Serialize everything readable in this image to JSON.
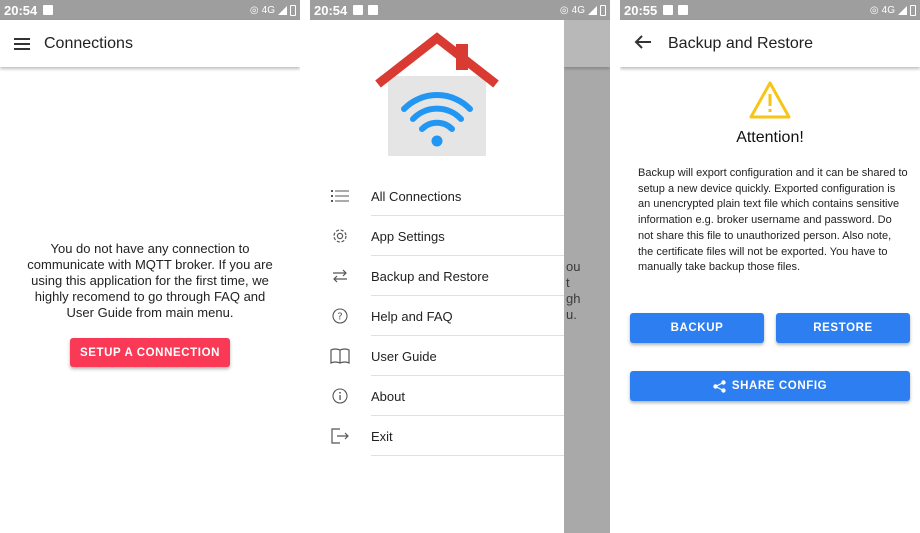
{
  "screen1": {
    "status_time": "20:54",
    "status_network": "4G",
    "title": "Connections",
    "empty_message": "You do not have any connection to communicate with MQTT broker. If you are using this application for the first time, we highly recomend to go through FAQ and User Guide from main menu.",
    "setup_button": "SETUP A CONNECTION"
  },
  "screen2": {
    "status_time": "20:54",
    "status_network": "4G",
    "background_text": [
      "ou",
      "t",
      "gh",
      "u."
    ],
    "drawer_items": [
      {
        "label": "All Connections",
        "icon": "list-icon"
      },
      {
        "label": "App Settings",
        "icon": "gear-icon"
      },
      {
        "label": "Backup and Restore",
        "icon": "swap-icon"
      },
      {
        "label": "Help and FAQ",
        "icon": "help-icon"
      },
      {
        "label": "User Guide",
        "icon": "book-icon"
      },
      {
        "label": "About",
        "icon": "info-icon"
      },
      {
        "label": "Exit",
        "icon": "exit-icon"
      }
    ]
  },
  "screen3": {
    "status_time": "20:55",
    "status_network": "4G",
    "title": "Backup and Restore",
    "attention": "Attention!",
    "paragraph": "Backup will export configuration and it can be shared to setup a new device quickly. Exported configuration is an unencrypted plain text file which contains sensitive information e.g. broker username and password. Do not share this file to unauthorized person. Also note, the certificate files will not be exported. You have to manually take backup those files.",
    "backup_button": "BACKUP",
    "restore_button": "RESTORE",
    "share_button": "SHARE CONFIG"
  },
  "colors": {
    "setup_button": "#fa3956",
    "primary_button": "#2d7ef0",
    "warning": "#f5c518",
    "logo_roof": "#d93a32",
    "logo_wifi": "#2196f3"
  }
}
